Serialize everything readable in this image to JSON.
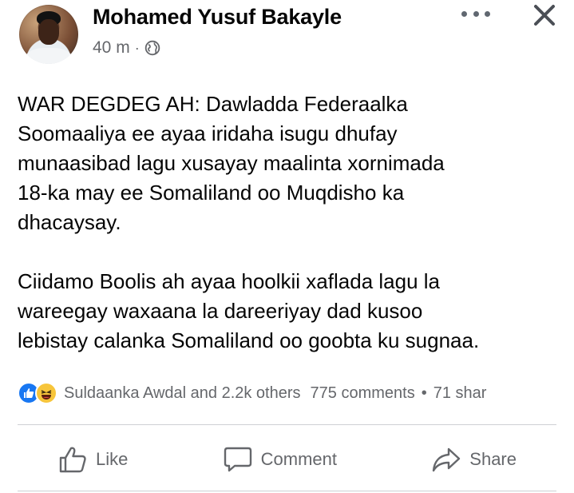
{
  "post": {
    "author": "Mohamed Yusuf Bakayle",
    "time": "40 m",
    "separator": "·",
    "paragraphs": [
      "WAR DEGDEG AH: Dawladda Federaalka\nSoomaaliya ee ayaa iridaha isugu dhufay\nmunaasibad lagu xusayay maalinta xornimada\n18-ka may ee Somaliland oo Muqdisho ka\ndhacaysay.",
      "Ciidamo Boolis ah ayaa hoolkii xaflada lagu la\nwareegay waxaana la dareeriyay dad kusoo\nlebistay calanka Somaliland oo goobta ku sugnaa."
    ]
  },
  "stats": {
    "reactors": "Suldaanka Awdal and 2.2k others",
    "comments": "775 comments",
    "bullet": "•",
    "shares": "71 shar"
  },
  "actions": {
    "like": "Like",
    "comment": "Comment",
    "share": "Share"
  },
  "colors": {
    "like_blue": "#1877f2",
    "haha_yellow": "#f7c53b",
    "secondary_text": "#65676b"
  }
}
